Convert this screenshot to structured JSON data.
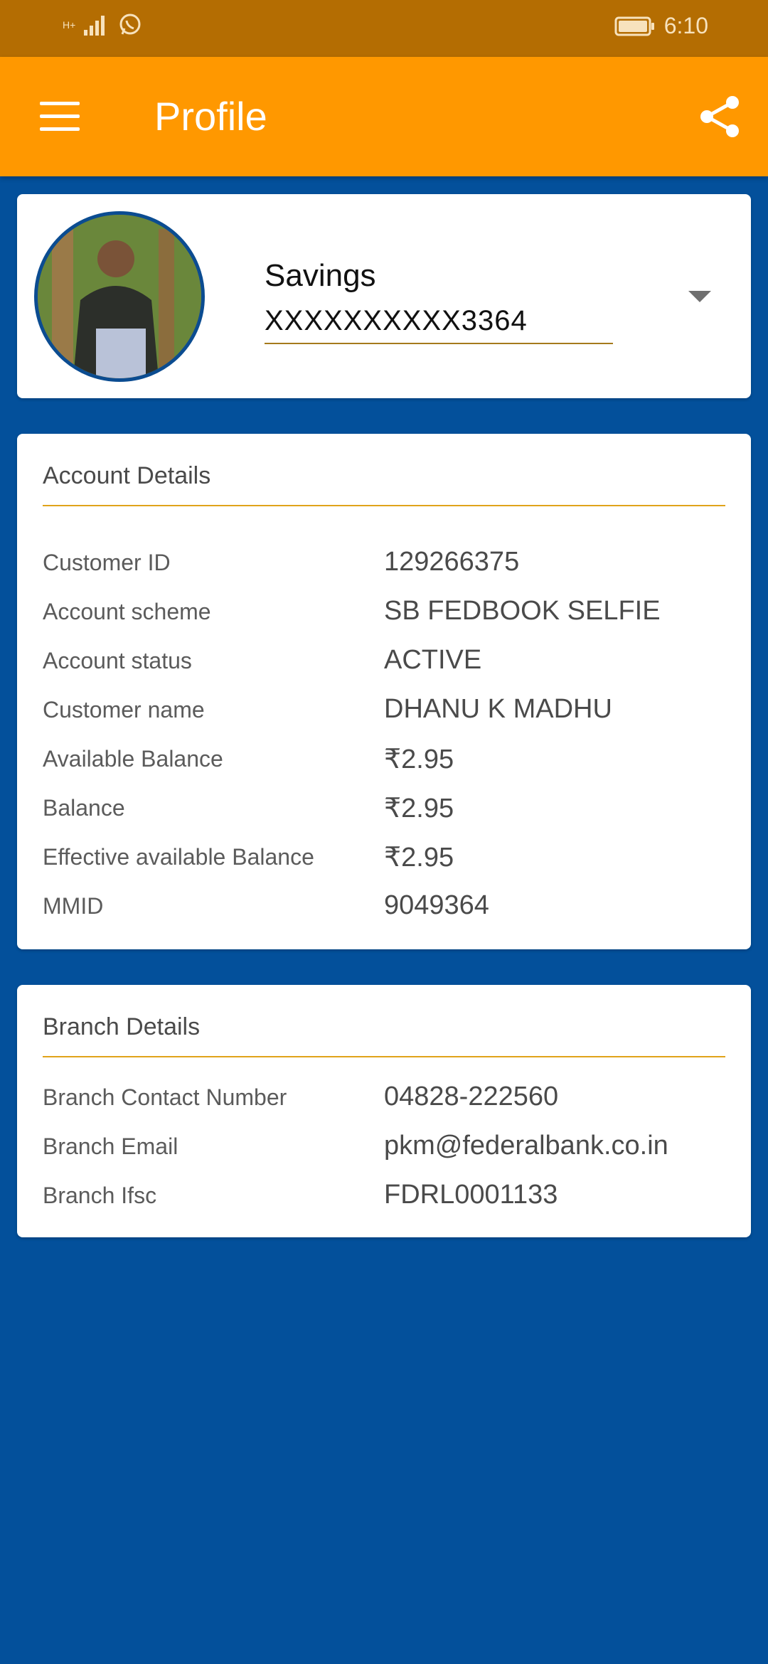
{
  "status_bar": {
    "network_label": "H+",
    "time": "6:10",
    "whatsapp_icon": "whatsapp-icon",
    "signal_icon": "signal-icon",
    "battery_icon": "battery-icon"
  },
  "app_bar": {
    "title": "Profile",
    "menu_icon": "hamburger-menu-icon",
    "share_icon": "share-icon",
    "background_color": "#ff9800"
  },
  "account_selector": {
    "account_type": "Savings",
    "account_number": "XXXXXXXXXX3364"
  },
  "account_details": {
    "title": "Account Details",
    "rows": [
      {
        "label": "Customer ID",
        "value": "129266375"
      },
      {
        "label": "Account scheme",
        "value": "SB FEDBOOK SELFIE"
      },
      {
        "label": "Account status",
        "value": "ACTIVE"
      },
      {
        "label": "Customer name",
        "value": "DHANU K MADHU"
      },
      {
        "label": "Available Balance",
        "value": "₹2.95"
      },
      {
        "label": "Balance",
        "value": "₹2.95"
      },
      {
        "label": "Effective available Balance",
        "value": "₹2.95"
      },
      {
        "label": "MMID",
        "value": "9049364"
      }
    ]
  },
  "branch_details": {
    "title": "Branch Details",
    "rows": [
      {
        "label": "Branch Contact Number",
        "value": "04828-222560"
      },
      {
        "label": "Branch Email",
        "value": "pkm@federalbank.co.in"
      },
      {
        "label": "Branch Ifsc",
        "value": "FDRL0001133"
      }
    ]
  },
  "colors": {
    "page_background": "#03509b",
    "status_bar": "#b46d02",
    "accent_rule": "#e0a31a"
  }
}
